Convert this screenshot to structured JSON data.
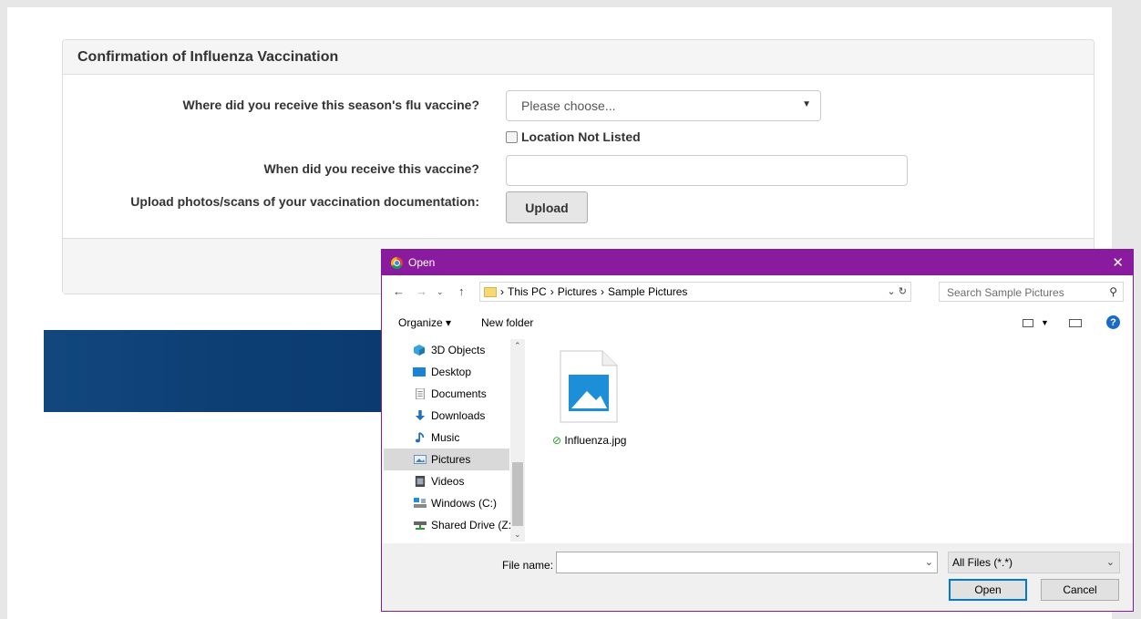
{
  "form": {
    "panel_title": "Confirmation of Influenza Vaccination",
    "q1_label": "Where did you receive this season's flu vaccine?",
    "q1_placeholder": "Please choose...",
    "location_not_listed": "Location Not Listed",
    "q2_label": "When did you receive this vaccine?",
    "q3_label": "Upload photos/scans of your vaccination documentation:",
    "upload_button": "Upload"
  },
  "dialog": {
    "title": "Open",
    "breadcrumb": [
      "This PC",
      "Pictures",
      "Sample Pictures"
    ],
    "search_placeholder": "Search Sample Pictures",
    "organize": "Organize",
    "new_folder": "New folder",
    "help": "?",
    "nav_items": [
      {
        "label": "3D Objects",
        "icon": "3d-objects-icon",
        "selected": false
      },
      {
        "label": "Desktop",
        "icon": "desktop-icon",
        "selected": false
      },
      {
        "label": "Documents",
        "icon": "documents-icon",
        "selected": false
      },
      {
        "label": "Downloads",
        "icon": "downloads-icon",
        "selected": false
      },
      {
        "label": "Music",
        "icon": "music-icon",
        "selected": false
      },
      {
        "label": "Pictures",
        "icon": "pictures-icon",
        "selected": true
      },
      {
        "label": "Videos",
        "icon": "videos-icon",
        "selected": false
      },
      {
        "label": "Windows (C:)",
        "icon": "drive-icon",
        "selected": false
      },
      {
        "label": "Shared Drive (Z:)",
        "icon": "network-drive-icon",
        "selected": false
      }
    ],
    "file": {
      "name": "Influenza.jpg",
      "status": "synced-check-icon"
    },
    "file_name_label": "File name:",
    "file_name_value": "",
    "file_type": "All Files (*.*)",
    "open_button": "Open",
    "cancel_button": "Cancel"
  },
  "colors": {
    "titlebar": "#8a1a9e",
    "banner": "#0d3f75",
    "accent": "#0078d7"
  }
}
